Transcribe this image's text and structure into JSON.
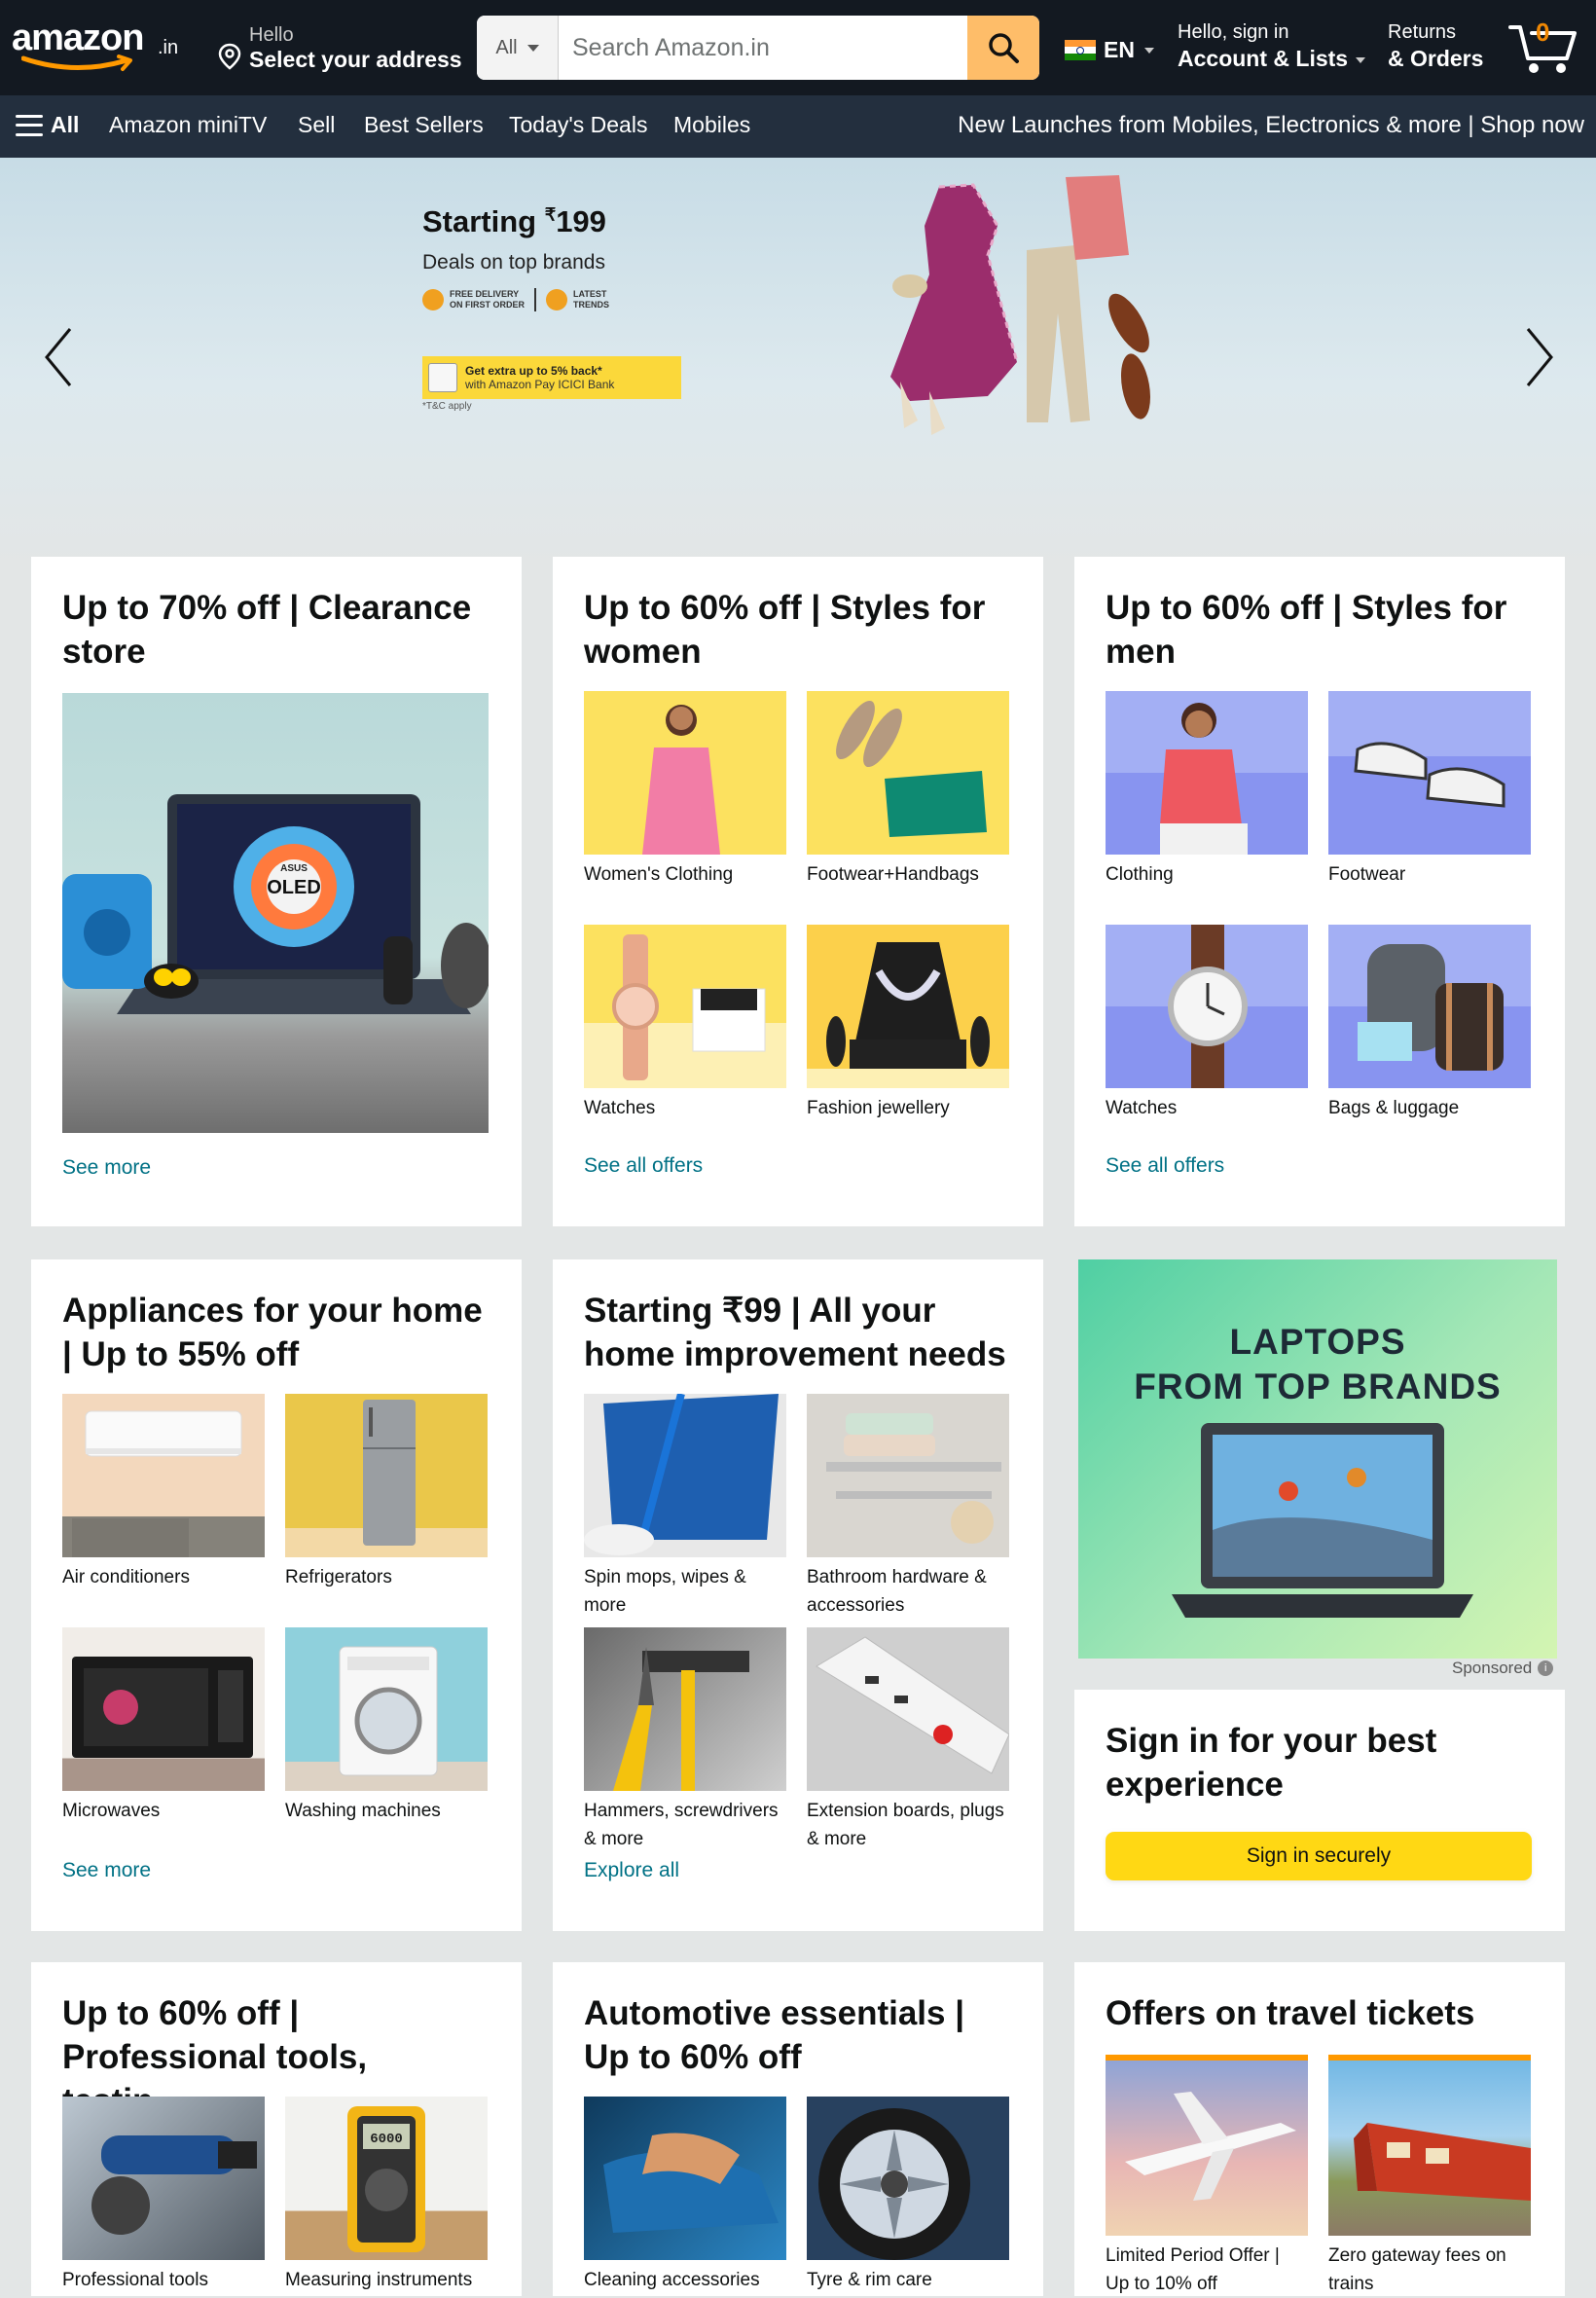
{
  "nav": {
    "logo_text": "amazon",
    "logo_suffix": ".in",
    "address_line1": "Hello",
    "address_line2": "Select your address",
    "search_category": "All",
    "search_placeholder": "Search Amazon.in",
    "language": "EN",
    "account_line1": "Hello, sign in",
    "account_line2": "Account & Lists",
    "returns_line1": "Returns",
    "returns_line2": "& Orders",
    "cart_count": "0"
  },
  "subnav": {
    "all_label": "All",
    "items": [
      "Amazon miniTV",
      "Sell",
      "Best Sellers",
      "Today's Deals",
      "Mobiles"
    ],
    "promo": "New Launches from Mobiles, Electronics & more | Shop now"
  },
  "hero": {
    "price_prefix": "Starting ",
    "price_currency": "₹",
    "price_value": "199",
    "subtitle": "Deals on top brands",
    "perk1_a": "FREE DELIVERY",
    "perk1_b": "ON FIRST ORDER",
    "perk2_a": "LATEST",
    "perk2_b": "TRENDS",
    "bank_line1": "Get extra up to 5% back*",
    "bank_line2": "with Amazon Pay ICICI Bank",
    "tc": "*T&C apply"
  },
  "cards": {
    "clearance": {
      "title": "Up to 70% off | Clearance store",
      "oled_brand": "ASUS",
      "oled_text": "OLED",
      "link": "See more"
    },
    "women": {
      "title": "Up to 60% off | Styles for women",
      "tiles": [
        "Women's Clothing",
        "Footwear+Handbags",
        "Watches",
        "Fashion jewellery"
      ],
      "link": "See all offers"
    },
    "men": {
      "title": "Up to 60% off | Styles for men",
      "tiles": [
        "Clothing",
        "Footwear",
        "Watches",
        "Bags & luggage"
      ],
      "link": "See all offers"
    },
    "appliances": {
      "title": "Appliances for your home | Up to 55% off",
      "tiles": [
        "Air conditioners",
        "Refrigerators",
        "Microwaves",
        "Washing machines"
      ],
      "link": "See more"
    },
    "home": {
      "title": "Starting ₹99 | All your home improvement needs",
      "tiles": [
        "Spin mops, wipes & more",
        "Bathroom hardware & accessories",
        "Hammers, screwdrivers & more",
        "Extension boards, plugs & more"
      ],
      "link": "Explore all"
    },
    "ad": {
      "title_line1": "LAPTOPS",
      "title_line2": "FROM TOP BRANDS",
      "sponsored": "Sponsored"
    },
    "signin": {
      "title": "Sign in for your best experience",
      "button": "Sign in securely"
    },
    "tools": {
      "title": "Up to 60% off | Professional tools, testin...",
      "tiles": [
        "Professional tools",
        "Measuring instruments"
      ],
      "meter_reading": "6000"
    },
    "auto": {
      "title": "Automotive essentials | Up to 60% off",
      "tiles": [
        "Cleaning accessories",
        "Tyre & rim care"
      ]
    },
    "travel": {
      "title": "Offers on travel tickets",
      "tiles": [
        "Limited Period Offer | Up to 10% off",
        "Zero gateway fees on trains"
      ]
    }
  },
  "colors": {
    "nav_bg": "#131921",
    "subnav_bg": "#232f3e",
    "search_btn": "#febd69",
    "link": "#007185",
    "signin_btn": "#ffd814",
    "cart_count": "#f08804"
  }
}
